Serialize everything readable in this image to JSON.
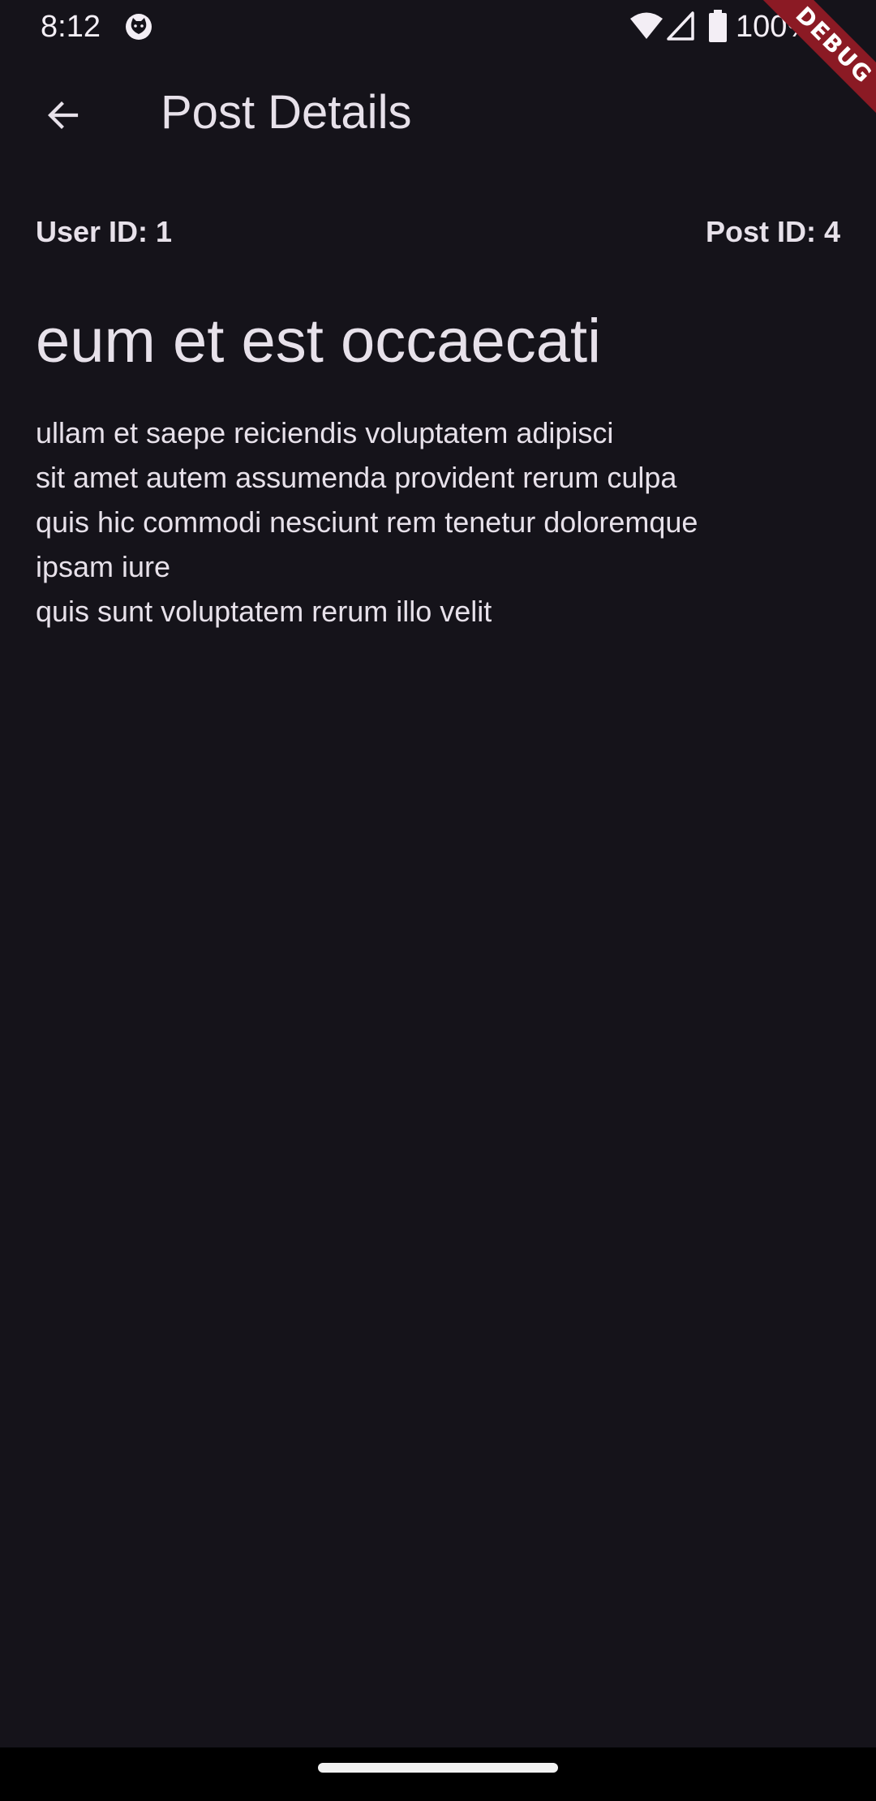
{
  "status_bar": {
    "time": "8:12",
    "battery": "100%",
    "icons": [
      "cat-icon",
      "wifi-icon",
      "signal-icon",
      "battery-icon"
    ]
  },
  "debug_banner": {
    "label": "DEBUG",
    "color": "#8b1a24"
  },
  "app_bar": {
    "back_icon": "arrow-left-icon",
    "title": "Post Details"
  },
  "post": {
    "user_id_label": "User ID: 1",
    "post_id_label": "Post ID: 4",
    "title": "eum et est occaecati",
    "body_lines": [
      "ullam et saepe reiciendis voluptatem adipisci",
      "sit amet autem assumenda provident rerum culpa",
      "quis hic commodi nesciunt rem tenetur doloremque",
      "ipsam iure",
      "quis sunt voluptatem rerum illo velit"
    ]
  },
  "colors": {
    "background": "#15131a",
    "text": "#e7e1ea",
    "nav_bar": "#000000"
  }
}
